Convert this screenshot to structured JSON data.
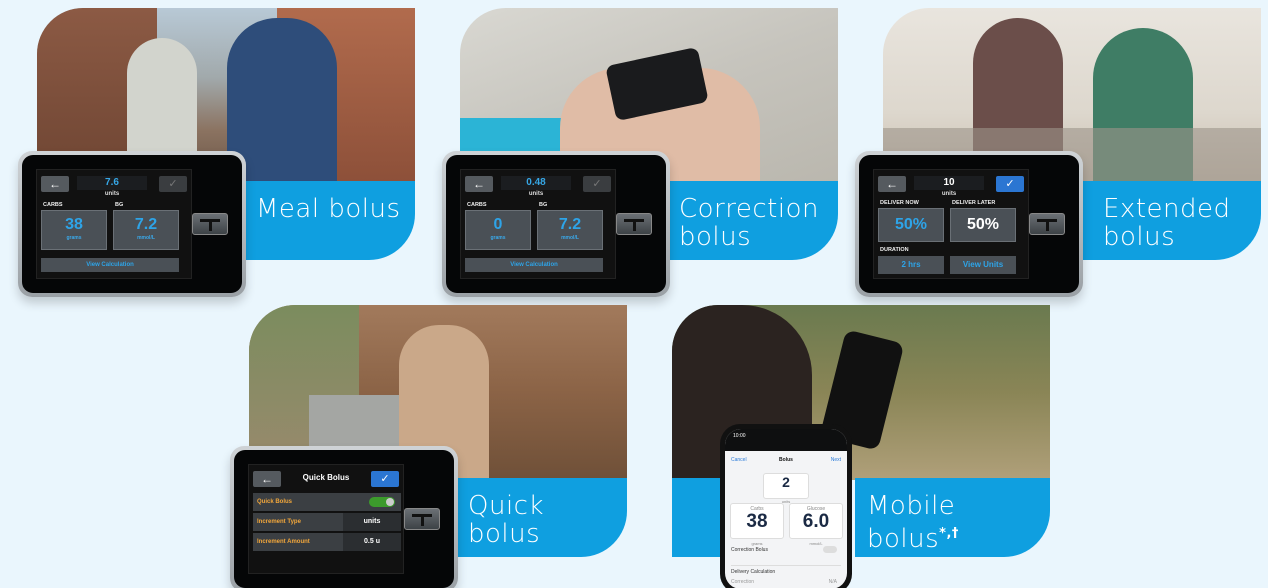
{
  "cards": {
    "meal": {
      "label": "Meal bolus",
      "screen": {
        "value": "7.6",
        "units": "units",
        "left_label": "CARBS",
        "right_label": "BG",
        "left_value": "38",
        "left_unit": "grams",
        "right_value": "7.2",
        "right_unit": "mmol/L",
        "bar": "View Calculation"
      }
    },
    "correction": {
      "label_line1": "Correction",
      "label_line2": "bolus",
      "screen": {
        "value": "0.48",
        "units": "units",
        "left_label": "CARBS",
        "right_label": "BG",
        "left_value": "0",
        "left_unit": "grams",
        "right_value": "7.2",
        "right_unit": "mmol/L",
        "bar": "View Calculation"
      }
    },
    "extended": {
      "label_line1": "Extended",
      "label_line2": "bolus",
      "screen": {
        "value": "10",
        "units": "units",
        "left_label": "DELIVER NOW",
        "right_label": "DELIVER LATER",
        "left_value": "50%",
        "right_value": "50%",
        "duration_label": "DURATION",
        "duration_value": "2 hrs",
        "view_units": "View Units"
      }
    },
    "quick": {
      "label_line1": "Quick",
      "label_line2": "bolus",
      "screen": {
        "title": "Quick Bolus",
        "row1": "Quick Bolus",
        "row2_key": "Increment Type",
        "row2_val": "units",
        "row3_key": "Increment Amount",
        "row3_val": "0.5 u"
      }
    },
    "mobile": {
      "label_line1": "Mobile",
      "label_line2": "bolus",
      "label_mark": "*,†",
      "phone": {
        "time": "10:00",
        "cancel": "Cancel",
        "title": "Bolus",
        "next": "Next",
        "units_value": "2",
        "units_label": "units",
        "carbs_label": "Carbs",
        "carbs_value": "38",
        "carbs_unit": "grams",
        "glucose_label": "Glucose",
        "glucose_value": "6.0",
        "glucose_unit": "mmol/L",
        "correction_bolus": "Correction Bolus",
        "delivery_calc": "Delivery Calculation",
        "correction": "Correction",
        "correction_val": "N/A"
      }
    }
  },
  "colors": {
    "background": "#eaf6fd",
    "banner": "#0f9fe0",
    "screen_blue": "#2ea4e8",
    "accent_orange": "#f2a73b"
  }
}
